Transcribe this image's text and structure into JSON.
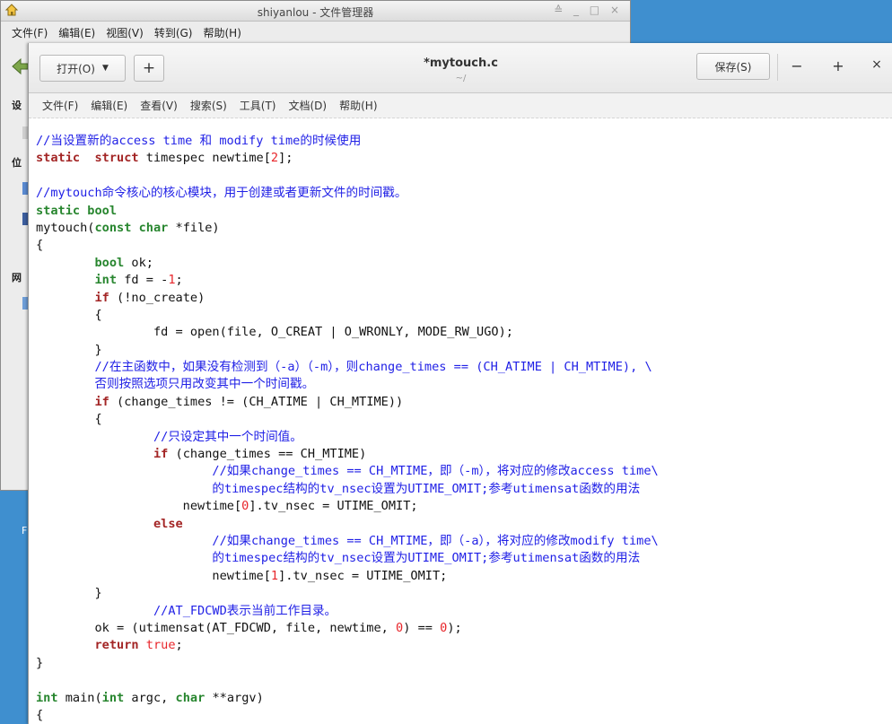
{
  "file_manager": {
    "title": "shiyanlou - 文件管理器",
    "window_controls": "≙ _ □ ×",
    "menu": [
      "文件(F)",
      "编辑(E)",
      "视图(V)",
      "转到(G)",
      "帮助(H)"
    ],
    "sidebar_labels": [
      "设",
      "位",
      "网"
    ],
    "desktop_label": "F"
  },
  "editor": {
    "open_label": "打开(O)",
    "open_caret": "▼",
    "new_tab_label": "+",
    "title": "*mytouch.c",
    "subtitle": "~/",
    "save_label": "保存(S)",
    "minimize_label": "−",
    "maximize_label": "+",
    "close_label": "×",
    "menu": [
      "文件(F)",
      "编辑(E)",
      "查看(V)",
      "搜索(S)",
      "工具(T)",
      "文档(D)",
      "帮助(H)"
    ]
  },
  "code_lines": [
    [
      [
        "cmt",
        "//当设置新的access time 和 modify time的时候使用"
      ]
    ],
    [
      [
        "kw",
        "static"
      ],
      [
        "",
        "  "
      ],
      [
        "kw",
        "struct"
      ],
      [
        "",
        " timespec newtime["
      ],
      [
        "num",
        "2"
      ],
      [
        "",
        "];"
      ]
    ],
    [
      [
        "",
        ""
      ]
    ],
    [
      [
        "cmt",
        "//mytouch命令核心的核心模块，用于创建或者更新文件的时间戳。"
      ]
    ],
    [
      [
        "ty",
        "static bool"
      ]
    ],
    [
      [
        "",
        "mytouch("
      ],
      [
        "ty",
        "const char"
      ],
      [
        "",
        " *file)"
      ]
    ],
    [
      [
        "",
        "{"
      ]
    ],
    [
      [
        "",
        "        "
      ],
      [
        "ty",
        "bool"
      ],
      [
        "",
        " ok;"
      ]
    ],
    [
      [
        "",
        "        "
      ],
      [
        "ty",
        "int"
      ],
      [
        "",
        " fd = -"
      ],
      [
        "num",
        "1"
      ],
      [
        "",
        ";"
      ]
    ],
    [
      [
        "",
        "        "
      ],
      [
        "kw",
        "if"
      ],
      [
        "",
        " (!no_create)"
      ]
    ],
    [
      [
        "",
        "        {"
      ]
    ],
    [
      [
        "",
        "                fd = open(file, O_CREAT | O_WRONLY, MODE_RW_UGO);"
      ]
    ],
    [
      [
        "",
        "        }"
      ]
    ],
    [
      [
        "",
        "        "
      ],
      [
        "cmt",
        "//在主函数中，如果没有检测到（-a）（-m），则change_times == (CH_ATIME | CH_MTIME), \\"
      ]
    ],
    [
      [
        "",
        "        "
      ],
      [
        "cmt",
        "否则按照选项只用改变其中一个时间戳。"
      ]
    ],
    [
      [
        "",
        "        "
      ],
      [
        "kw",
        "if"
      ],
      [
        "",
        " (change_times != (CH_ATIME | CH_MTIME))"
      ]
    ],
    [
      [
        "",
        "        {"
      ]
    ],
    [
      [
        "",
        "                "
      ],
      [
        "cmt",
        "//只设定其中一个时间值。"
      ]
    ],
    [
      [
        "",
        "                "
      ],
      [
        "kw",
        "if"
      ],
      [
        "",
        " (change_times == CH_MTIME)"
      ]
    ],
    [
      [
        "",
        "                        "
      ],
      [
        "cmt",
        "//如果change_times == CH_MTIME，即（-m），将对应的修改access time\\"
      ]
    ],
    [
      [
        "",
        "                        "
      ],
      [
        "cmt",
        "的timespec结构的tv_nsec设置为UTIME_OMIT;参考utimensat函数的用法"
      ]
    ],
    [
      [
        "",
        "                    newtime["
      ],
      [
        "num",
        "0"
      ],
      [
        "",
        "].tv_nsec = UTIME_OMIT;"
      ]
    ],
    [
      [
        "",
        "                "
      ],
      [
        "kw",
        "else"
      ]
    ],
    [
      [
        "",
        "                        "
      ],
      [
        "cmt",
        "//如果change_times == CH_MTIME，即（-a），将对应的修改modify time\\"
      ]
    ],
    [
      [
        "",
        "                        "
      ],
      [
        "cmt",
        "的timespec结构的tv_nsec设置为UTIME_OMIT;参考utimensat函数的用法"
      ]
    ],
    [
      [
        "",
        "                        newtime["
      ],
      [
        "num",
        "1"
      ],
      [
        "",
        "].tv_nsec = UTIME_OMIT;"
      ]
    ],
    [
      [
        "",
        "        }"
      ]
    ],
    [
      [
        "",
        "                "
      ],
      [
        "cmt",
        "//AT_FDCWD表示当前工作目录。"
      ]
    ],
    [
      [
        "",
        "        ok = (utimensat(AT_FDCWD, file, newtime, "
      ],
      [
        "num",
        "0"
      ],
      [
        "",
        ") == "
      ],
      [
        "num",
        "0"
      ],
      [
        "",
        ");"
      ]
    ],
    [
      [
        "",
        "        "
      ],
      [
        "kw",
        "return"
      ],
      [
        "",
        ""
      ],
      [
        "bool",
        " true"
      ],
      [
        "",
        ";"
      ]
    ],
    [
      [
        "",
        "}"
      ]
    ],
    [
      [
        "",
        ""
      ]
    ],
    [
      [
        "ty",
        "int"
      ],
      [
        "",
        " main("
      ],
      [
        "ty",
        "int"
      ],
      [
        "",
        " argc, "
      ],
      [
        "ty",
        "char"
      ],
      [
        "",
        " **argv)"
      ]
    ],
    [
      [
        "",
        "{"
      ]
    ]
  ]
}
